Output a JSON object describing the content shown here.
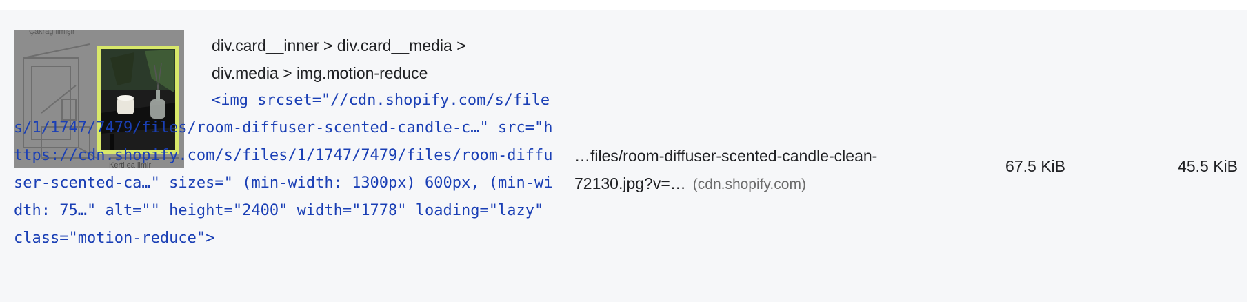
{
  "row": {
    "thumbnail": {
      "icon": "image-thumbnail",
      "caption_top": "Çakrağ ilmişir",
      "caption_bottom": "Kerti ea ilmir",
      "highlight_color": "#d9e86a"
    },
    "selector_line1": "div.card__inner > div.card__media >",
    "selector_line2": "div.media > img.motion-reduce",
    "snippet": "<img srcset=\"//cdn.shopify.com/s/files/1/1747/7479/files/room-diffuser-scented-candle-c…\" src=\"https://cdn.shopify.com/s/files/1/1747/7479/files/room-diffuser-scented-ca…\" sizes=\" (min-width: 1300px) 600px, (min-width: 75…\" alt=\"\" height=\"2400\" width=\"1778\" loading=\"lazy\" class=\"motion-reduce\">",
    "url_text": "…files/room-diffuser-scented-candle-clean-72130.jpg?v=…",
    "url_host": "(cdn.shopify.com)",
    "resource_size": "67.5 KiB",
    "potential_savings": "45.5 KiB"
  },
  "colors": {
    "row_background": "#f6f7f9",
    "snippet_text": "#1a3fb5",
    "host_text": "#6b6b6b"
  }
}
